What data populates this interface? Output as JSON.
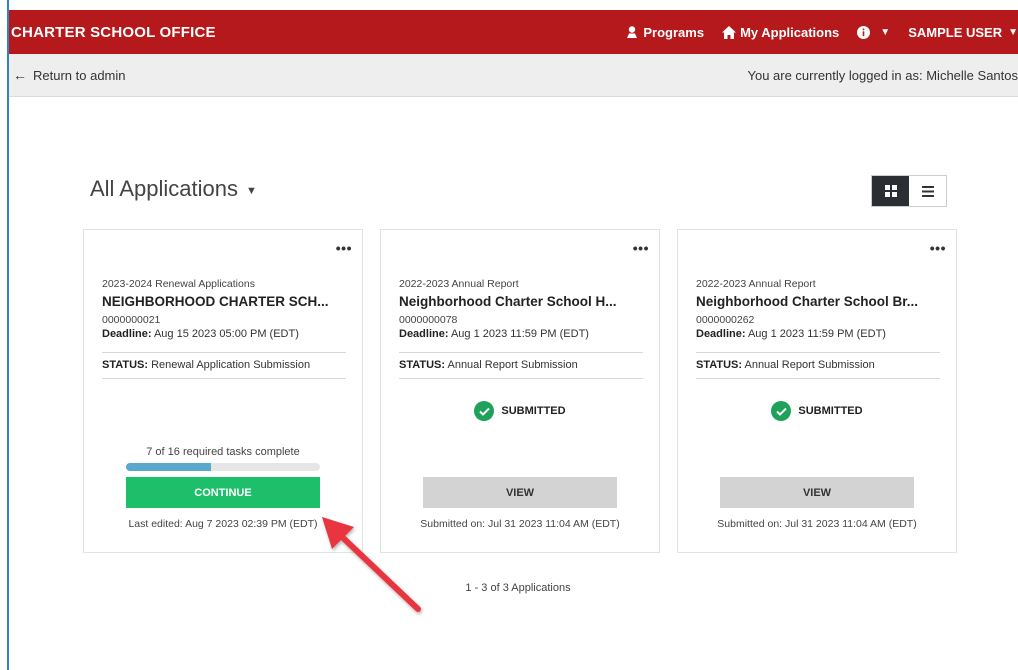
{
  "header": {
    "brand": "CHARTER SCHOOL OFFICE",
    "nav": {
      "programs": "Programs",
      "my_applications": "My Applications",
      "user": "SAMPLE USER"
    }
  },
  "subbar": {
    "return_label": "Return to admin",
    "logged_in_text": "You are currently logged in as: Michelle Santos"
  },
  "page": {
    "title": "All Applications"
  },
  "cards": [
    {
      "type": "2023-2024 Renewal Applications",
      "name": "NEIGHBORHOOD CHARTER SCH...",
      "id": "0000000021",
      "deadline_label": "Deadline:",
      "deadline": "Aug 15 2023 05:00 PM (EDT)",
      "status_label": "STATUS:",
      "status": "Renewal Application Submission",
      "progress_text": "7 of 16 required tasks complete",
      "progress_fraction": 0.4375,
      "button": "CONTINUE",
      "footer": "Last edited: Aug 7 2023 02:39 PM (EDT)"
    },
    {
      "type": "2022-2023 Annual Report",
      "name": "Neighborhood Charter School H...",
      "id": "0000000078",
      "deadline_label": "Deadline:",
      "deadline": "Aug 1 2023 11:59 PM (EDT)",
      "status_label": "STATUS:",
      "status": "Annual Report Submission",
      "submitted_label": "SUBMITTED",
      "button": "VIEW",
      "footer": "Submitted on: Jul 31 2023 11:04 AM (EDT)"
    },
    {
      "type": "2022-2023 Annual Report",
      "name": "Neighborhood Charter School Br...",
      "id": "0000000262",
      "deadline_label": "Deadline:",
      "deadline": "Aug 1 2023 11:59 PM (EDT)",
      "status_label": "STATUS:",
      "status": "Annual Report Submission",
      "submitted_label": "SUBMITTED",
      "button": "VIEW",
      "footer": "Submitted on: Jul 31 2023 11:04 AM (EDT)"
    }
  ],
  "pager": {
    "text": "1 - 3 of 3 Applications"
  },
  "colors": {
    "header_bg": "#b5191c",
    "continue_btn": "#1dbf6b",
    "progress_fill": "#5aa8cc",
    "submitted_check": "#1fa15a",
    "annotation_arrow": "#e8343f"
  },
  "icons": {
    "programs": "person-badge-icon",
    "my_applications": "home-icon",
    "info": "info-circle-icon",
    "grid_view": "grid-icon",
    "list_view": "list-icon"
  }
}
